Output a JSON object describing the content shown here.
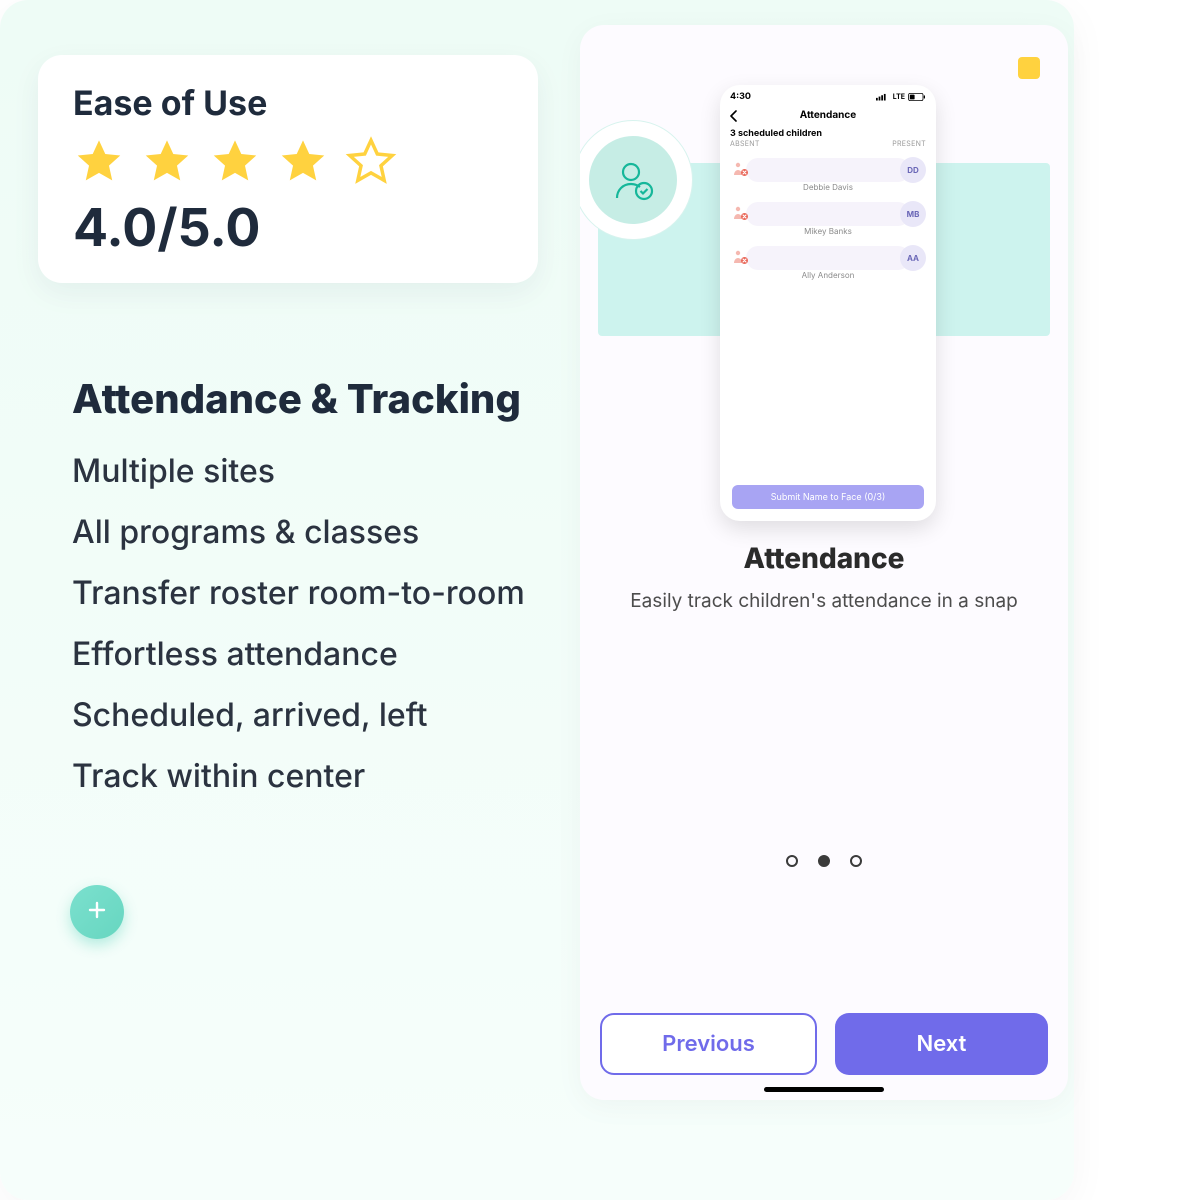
{
  "rating": {
    "title": "Ease of Use",
    "score": "4.0/5.0",
    "filled_stars": 4,
    "total_stars": 5
  },
  "features": {
    "title": "Attendance & Tracking",
    "items": [
      "Multiple sites",
      "All programs & classes",
      "Transfer roster room-to-room",
      "Effortless attendance",
      "Scheduled, arrived, left",
      "Track within center"
    ]
  },
  "phone": {
    "time": "4:30",
    "network_label": "LTE",
    "title": "Attendance",
    "subtitle": "3 scheduled children",
    "col_left": "ABSENT",
    "col_right": "PRESENT",
    "children": [
      {
        "name": "Debbie Davis",
        "initials": "DD"
      },
      {
        "name": "Mikey Banks",
        "initials": "MB"
      },
      {
        "name": "Ally Anderson",
        "initials": "AA"
      }
    ],
    "submit": "Submit Name to Face (0/3)"
  },
  "under": {
    "title": "Attendance",
    "subtitle": "Easily track children's attendance in a snap"
  },
  "nav": {
    "prev": "Previous",
    "next": "Next"
  },
  "colors": {
    "star": "#ffd23f",
    "accent": "#706bea",
    "teal": "#27c6a6"
  }
}
